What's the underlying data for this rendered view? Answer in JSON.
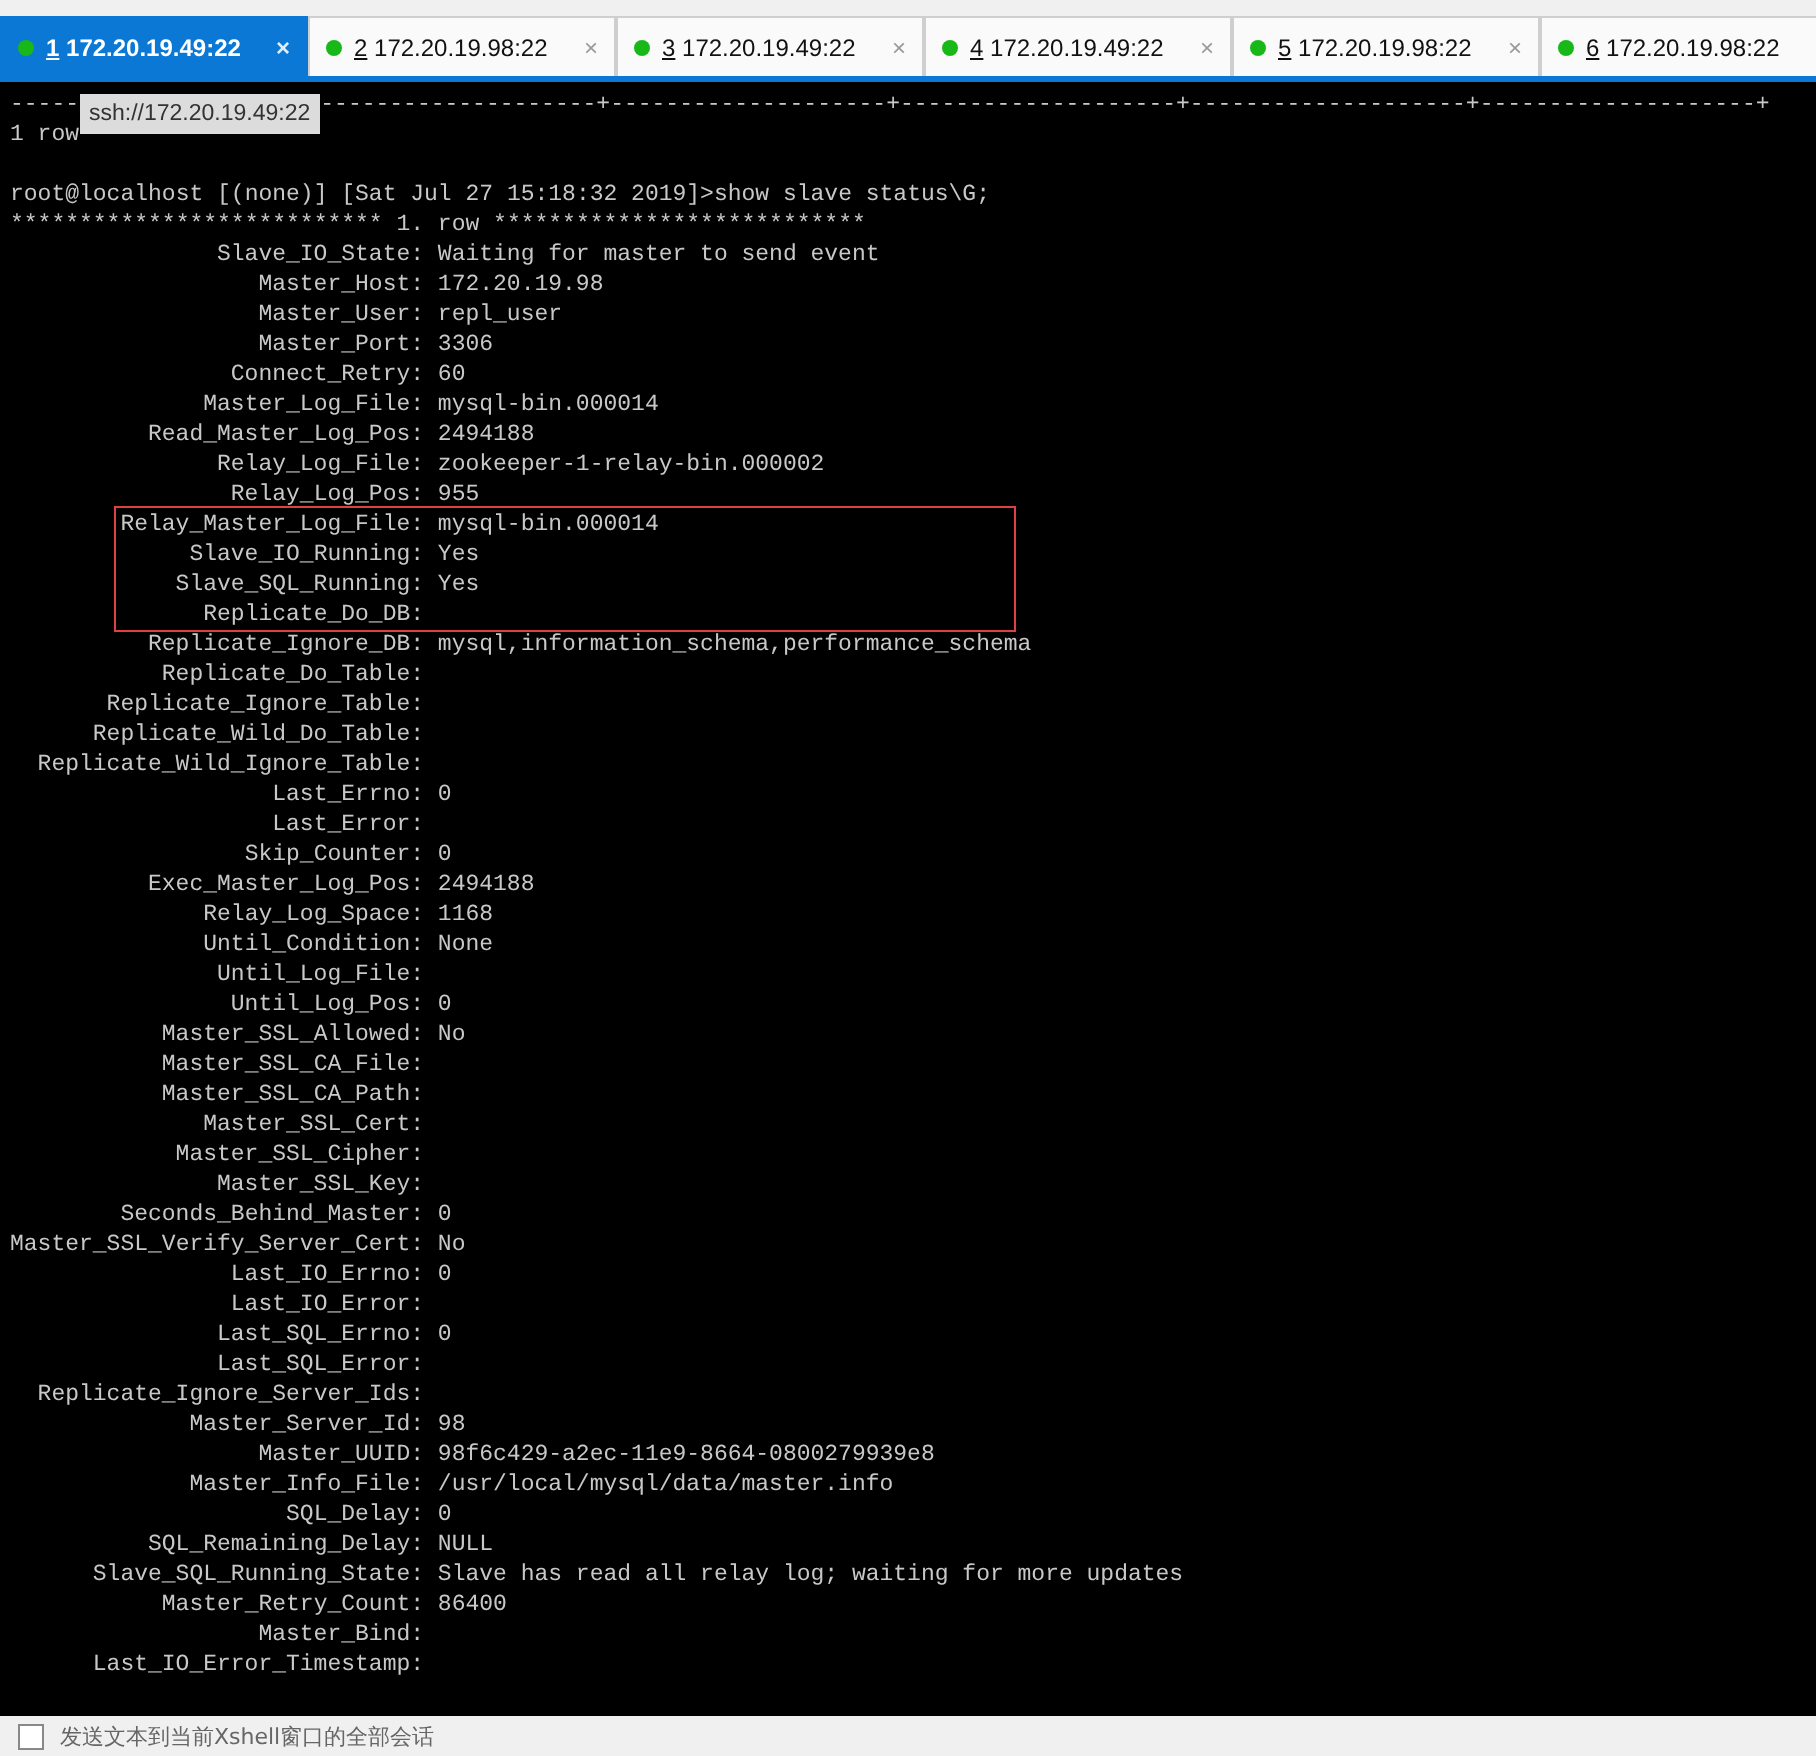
{
  "tabs": [
    {
      "number": "1",
      "host": "172.20.19.49:22",
      "selected": true,
      "connected": true,
      "close": "×"
    },
    {
      "number": "2",
      "host": "172.20.19.98:22",
      "selected": false,
      "connected": true,
      "close": "×"
    },
    {
      "number": "3",
      "host": "172.20.19.49:22",
      "selected": false,
      "connected": true,
      "close": "×"
    },
    {
      "number": "4",
      "host": "172.20.19.49:22",
      "selected": false,
      "connected": true,
      "close": "×"
    },
    {
      "number": "5",
      "host": "172.20.19.98:22",
      "selected": false,
      "connected": true,
      "close": "×"
    },
    {
      "number": "6",
      "host": "172.20.19.98:22",
      "selected": false,
      "connected": true
    }
  ],
  "terminal": {
    "lines": [
      {
        "kind": "separator",
        "parts": [
          "-----",
          "--------------------+--------------------+--------------------+--------------------+--------------------+"
        ]
      },
      {
        "kind": "output",
        "parts": [
          "1 row"
        ]
      },
      {
        "kind": "prompt",
        "parts": [
          "root@localhost [(none)] [Sat Jul 27 15:18:32 2019]>show slave status\\G;"
        ]
      },
      {
        "kind": "output",
        "parts": [
          "*************************** 1. row ***************************"
        ]
      }
    ],
    "rows": [
      {
        "field": "Slave_IO_State:",
        "value": "Waiting for master to send event",
        "highlighted": false
      },
      {
        "field": "Master_Host:",
        "value": "172.20.19.98",
        "highlighted": false
      },
      {
        "field": "Master_User:",
        "value": "repl_user",
        "highlighted": false
      },
      {
        "field": "Master_Port:",
        "value": "3306",
        "highlighted": false
      },
      {
        "field": "Connect_Retry:",
        "value": "60",
        "highlighted": false
      },
      {
        "field": "Master_Log_File:",
        "value": "mysql-bin.000014",
        "highlighted": false
      },
      {
        "field": "Read_Master_Log_Pos:",
        "value": "2494188",
        "highlighted": false
      },
      {
        "field": "Relay_Log_File:",
        "value": "zookeeper-1-relay-bin.000002",
        "highlighted": false
      },
      {
        "field": "Relay_Log_Pos:",
        "value": "955",
        "highlighted": false
      },
      {
        "field": "Relay_Master_Log_File:",
        "value": "mysql-bin.000014",
        "highlighted": true
      },
      {
        "field": "Slave_IO_Running:",
        "value": "Yes",
        "highlighted": true
      },
      {
        "field": "Slave_SQL_Running:",
        "value": "Yes",
        "highlighted": true
      },
      {
        "field": "Replicate_Do_DB:",
        "highlighted": true
      },
      {
        "field": "Replicate_Ignore_DB:",
        "value": "mysql,information_schema,performance_schema",
        "highlighted": false
      },
      {
        "field": "Replicate_Do_Table:",
        "highlighted": false
      },
      {
        "field": "Replicate_Ignore_Table:",
        "highlighted": false
      },
      {
        "field": "Replicate_Wild_Do_Table:",
        "highlighted": false
      },
      {
        "field": "Replicate_Wild_Ignore_Table:",
        "highlighted": false
      },
      {
        "field": "Last_Errno:",
        "value": "0",
        "highlighted": false
      },
      {
        "field": "Last_Error:",
        "highlighted": false
      },
      {
        "field": "Skip_Counter:",
        "value": "0",
        "highlighted": false
      },
      {
        "field": "Exec_Master_Log_Pos:",
        "value": "2494188",
        "highlighted": false
      },
      {
        "field": "Relay_Log_Space:",
        "value": "1168",
        "highlighted": false
      },
      {
        "field": "Until_Condition:",
        "value": "None",
        "highlighted": false
      },
      {
        "field": "Until_Log_File:",
        "highlighted": false
      },
      {
        "field": "Until_Log_Pos:",
        "value": "0",
        "highlighted": false
      },
      {
        "field": "Master_SSL_Allowed:",
        "value": "No",
        "highlighted": false
      },
      {
        "field": "Master_SSL_CA_File:",
        "highlighted": false
      },
      {
        "field": "Master_SSL_CA_Path:",
        "highlighted": false
      },
      {
        "field": "Master_SSL_Cert:",
        "highlighted": false
      },
      {
        "field": "Master_SSL_Cipher:",
        "highlighted": false
      },
      {
        "field": "Master_SSL_Key:",
        "highlighted": false
      },
      {
        "field": "Seconds_Behind_Master:",
        "value": "0",
        "highlighted": false
      },
      {
        "field": "Master_SSL_Verify_Server_Cert:",
        "value": "No",
        "highlighted": false
      },
      {
        "field": "Last_IO_Errno:",
        "value": "0",
        "highlighted": false
      },
      {
        "field": "Last_IO_Error:",
        "highlighted": false
      },
      {
        "field": "Last_SQL_Errno:",
        "value": "0",
        "highlighted": false
      },
      {
        "field": "Last_SQL_Error:",
        "highlighted": false
      },
      {
        "field": "Replicate_Ignore_Server_Ids:",
        "highlighted": false
      },
      {
        "field": "Master_Server_Id:",
        "value": "98",
        "highlighted": false
      },
      {
        "field": "Master_UUID:",
        "value": "98f6c429-a2ec-11e9-8664-0800279939e8",
        "highlighted": false
      },
      {
        "field": "Master_Info_File:",
        "value": "/usr/local/mysql/data/master.info",
        "highlighted": false
      },
      {
        "field": "SQL_Delay:",
        "value": "0",
        "highlighted": false
      },
      {
        "field": "SQL_Remaining_Delay:",
        "value": "NULL",
        "highlighted": false
      },
      {
        "field": "Slave_SQL_Running_State:",
        "value": "Slave has read all relay log; waiting for more updates",
        "highlighted": false
      },
      {
        "field": "Master_Retry_Count:",
        "value": "86400",
        "highlighted": false
      },
      {
        "field": "Master_Bind:",
        "highlighted": false
      },
      {
        "field": "Last_IO_Error_Timestamp:",
        "highlighted": false
      }
    ]
  },
  "tooltip": "ssh://172.20.19.49:22",
  "compose_bar": {
    "checked": false,
    "label": "发送文本到当前Xshell窗口的全部会话"
  }
}
